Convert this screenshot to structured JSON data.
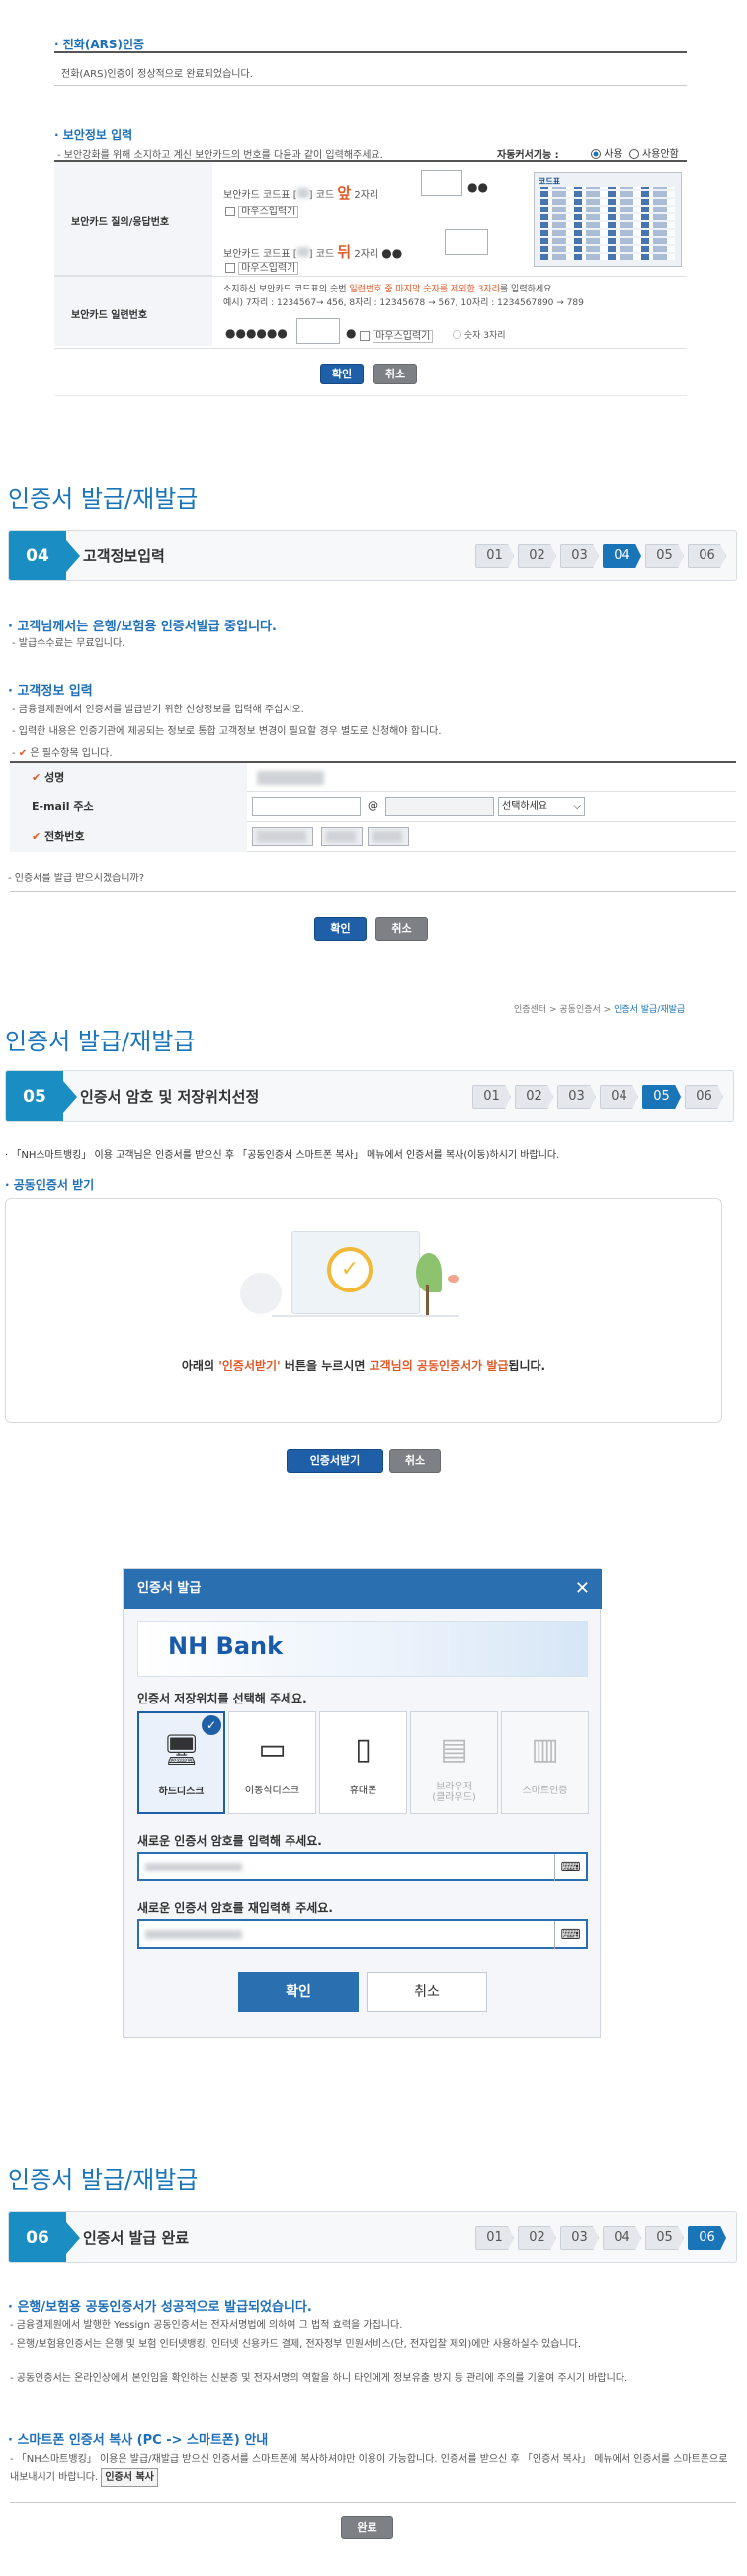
{
  "ars": {
    "title": "전화(ARS)인증",
    "message": "전화(ARS)인증이 정상적으로 완료되었습니다."
  },
  "security": {
    "title": "보안정보 입력",
    "desc": "- 보안강화를 위해 소지하고 계신 보안카드의 번호를 다음과 같이 입력해주세요.",
    "auto_cursor_label": "자동커서기능 :",
    "opt_use": "사용",
    "opt_nouse": "사용안함",
    "card_label": "보안카드 질의/응답번호",
    "code1_prefix": "보안카드 코드표 [",
    "code_mid": "] 코드",
    "front": "앞",
    "front_digits": "2자리",
    "back": "뒤",
    "back_digits": "2자리",
    "mouse_input": "마우스입력기",
    "serial_label": "보안카드 일련번호",
    "serial_desc1": "소지하신 보안카드 코드표의 숫번",
    "serial_desc1b": "일련번호 중 마지막 숫자를 제외한 3자리",
    "serial_desc1c": "를 입력하세요.",
    "serial_desc2": "예시) 7자리 : 1234567→ 456, 8자리 : 12345678 → 567, 10자리 : 1234567890 → 789",
    "serial_dots": "●●●●●●",
    "serial_dot": "●",
    "digits_note": "숫자 3자리",
    "card_img_title": "코드표",
    "confirm": "확인",
    "cancel": "취소"
  },
  "s04": {
    "heading": "인증서 발급/재발급",
    "step": "04",
    "label": "고객정보입력",
    "steps": [
      "01",
      "02",
      "03",
      "04",
      "05",
      "06"
    ],
    "notice_title": "고객님께서는 은행/보험용 인증서발급 중입니다.",
    "notice_sub": "- 발급수수료는 무료입니다.",
    "info_title": "고객정보 입력",
    "info_l1": "- 금융결제원에서 인증서를 발급받기 위한 신상정보를 입력해 주십시오.",
    "info_l2": "- 입력한 내용은 인증기관에 제공되는 정보로 통합 고객정보 변경이 필요할 경우 별도로 신청해야 합니다.",
    "info_l3": "은 필수항목 입니다.",
    "name_label": "성명",
    "email_label": "E-mail 주소",
    "at": "@",
    "email_select": "선택하세요",
    "phone_label": "전화번호",
    "question": "- 인증서를 발급 받으시겠습니까?",
    "confirm": "확인",
    "cancel": "취소"
  },
  "s05": {
    "breadcrumb_a": "인증센터",
    "breadcrumb_b": "공동인증서",
    "breadcrumb_c": "인증서 발급/재발급",
    "heading": "인증서 발급/재발급",
    "step": "05",
    "label": "인증서 암호 및 저장위치선정",
    "steps": [
      "01",
      "02",
      "03",
      "04",
      "05",
      "06"
    ],
    "notice": "「NH스마트뱅킹」 이용 고객님은 인증서를 받으신 후 「공동인증서 스마트폰 복사」 메뉴에서 인증서를 복사(이동)하시기 바랍니다.",
    "receive_title": "공동인증서 받기",
    "msg_a": "아래의 ",
    "msg_b": "'인증서받기'",
    "msg_c": " 버튼을 누르시면 ",
    "msg_d": "고객님의 공동인증서가 발급",
    "msg_e": "됩니다.",
    "receive_btn": "인증서받기",
    "cancel": "취소"
  },
  "modal": {
    "title": "인증서 발급",
    "bank": "NH Bank",
    "select_location": "인증서 저장위치를 선택해 주세요.",
    "locations": [
      "하드디스크",
      "이동식디스크",
      "휴대폰",
      "브라우저\n(클라우드)",
      "스마트인증"
    ],
    "pw_label": "새로운 인증서 암호를 입력해 주세요.",
    "pw_confirm_label": "새로운 인증서 암호를 재입력해 주세요.",
    "ok": "확인",
    "cancel": "취소"
  },
  "s06": {
    "heading": "인증서 발급/재발급",
    "step": "06",
    "label": "인증서 발급 완료",
    "steps": [
      "01",
      "02",
      "03",
      "04",
      "05",
      "06"
    ],
    "done_title": "은행/보험용 공동인증서가 성공적으로 발급되었습니다.",
    "done_l1": "- 금융결제원에서 발행한 Yessign 공동인증서는 전자서명법에 의하여 그 법적 효력을 가집니다.",
    "done_l2": "- 은행/보험용인증서는 은행 및 보험 인터넷뱅킹, 인터넷 신용카드 결제, 전자정부 민원서비스(단, 전자입찰 제외)에만 사용하실수 있습니다.",
    "done_l3": "- 공동인증서는 온라인상에서 본인임을 확인하는 신분증 및 전자서명의 역할을 하니 타인에게 정보유출 방지 등 관리에 주의를 기울여 주시기 바랍니다.",
    "copy_title": "스마트폰 인증서 복사 (PC -> 스마트폰) 안내",
    "copy_l1": "- 「NH스마트뱅킹」 이용은 발급/재발급 받으신 인증서를 스마트폰에 복사하셔야만 이용이 가능합니다. 인증서를 받으신 후 「인증서 복사」 메뉴에서 인증서를 스마트폰으로 내보내시기 바랍니다.",
    "copy_btn": "인증서 복사",
    "done_btn": "완료"
  }
}
